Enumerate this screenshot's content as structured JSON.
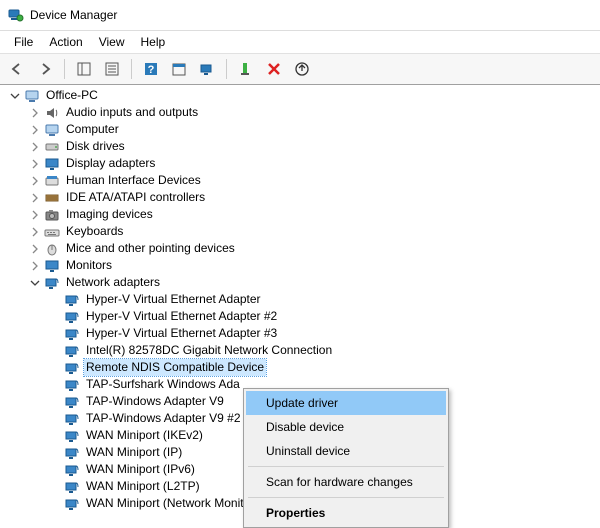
{
  "window": {
    "title": "Device Manager"
  },
  "menubar": {
    "file": "File",
    "action": "Action",
    "view": "View",
    "help": "Help"
  },
  "tree": {
    "root": "Office-PC",
    "categories": [
      "Audio inputs and outputs",
      "Computer",
      "Disk drives",
      "Display adapters",
      "Human Interface Devices",
      "IDE ATA/ATAPI controllers",
      "Imaging devices",
      "Keyboards",
      "Mice and other pointing devices",
      "Monitors",
      "Network adapters"
    ],
    "network_devices": [
      "Hyper-V Virtual Ethernet Adapter",
      "Hyper-V Virtual Ethernet Adapter #2",
      "Hyper-V Virtual Ethernet Adapter #3",
      "Intel(R) 82578DC Gigabit Network Connection",
      "Remote NDIS Compatible Device",
      "TAP-Surfshark Windows Ada",
      "TAP-Windows Adapter V9",
      "TAP-Windows Adapter V9 #2",
      "WAN Miniport (IKEv2)",
      "WAN Miniport (IP)",
      "WAN Miniport (IPv6)",
      "WAN Miniport (L2TP)",
      "WAN Miniport (Network Monitor)"
    ]
  },
  "context_menu": {
    "update": "Update driver",
    "disable": "Disable device",
    "uninstall": "Uninstall device",
    "scan": "Scan for hardware changes",
    "properties": "Properties"
  }
}
